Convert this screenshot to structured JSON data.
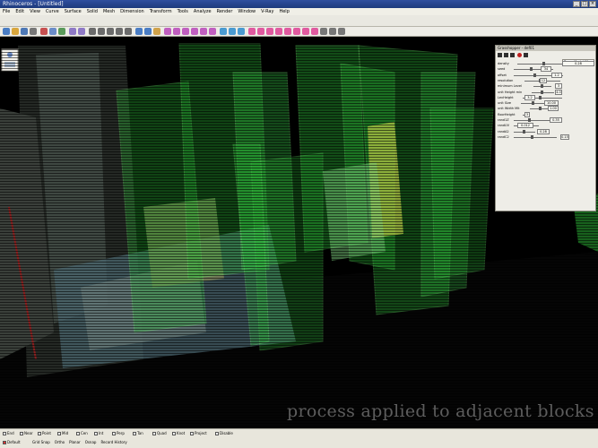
{
  "window": {
    "title": "Rhinoceros - [Untitled]",
    "controls": [
      "_",
      "□",
      "×"
    ]
  },
  "menus": [
    "File",
    "Edit",
    "View",
    "Curve",
    "Surface",
    "Solid",
    "Mesh",
    "Dimension",
    "Transform",
    "Tools",
    "Analyze",
    "Render",
    "Window",
    "V-Ray",
    "Help"
  ],
  "grasshopper": {
    "title": "Grasshopper - def01",
    "document_name": "Tower Model 01",
    "params": [
      {
        "label": "density",
        "value": "0.28"
      },
      {
        "label": "seed",
        "value": "34"
      },
      {
        "label": "offset",
        "value": "1.2"
      },
      {
        "label": "resolution",
        "value": "12"
      },
      {
        "label": "minimum Level",
        "value": "3"
      },
      {
        "label": "unit Height min",
        "value": "4.0"
      },
      {
        "label": "LevHeight",
        "value": "3.2"
      },
      {
        "label": "unit Size",
        "value": "10.00"
      },
      {
        "label": "unit Width Mlt",
        "value": "1.00"
      },
      {
        "label": "floorHeight",
        "value": "3"
      },
      {
        "label": "rand1Z",
        "value": "0.35"
      },
      {
        "label": "randUV",
        "value": "0.012"
      },
      {
        "label": "randA2",
        "value": "0.28"
      },
      {
        "label": "randC2",
        "value": "0.15"
      }
    ]
  },
  "status": {
    "osnaps": [
      "End",
      "Near",
      "Point",
      "Mid",
      "Cen",
      "Int",
      "Perp",
      "Tan",
      "Quad",
      "Knot",
      "Project",
      "Disable"
    ],
    "modes": [
      "Grid Snap",
      "Ortho",
      "Planar",
      "Osnap",
      "Record History"
    ],
    "units": "Default"
  },
  "caption": "process applied to adjacent blocks"
}
